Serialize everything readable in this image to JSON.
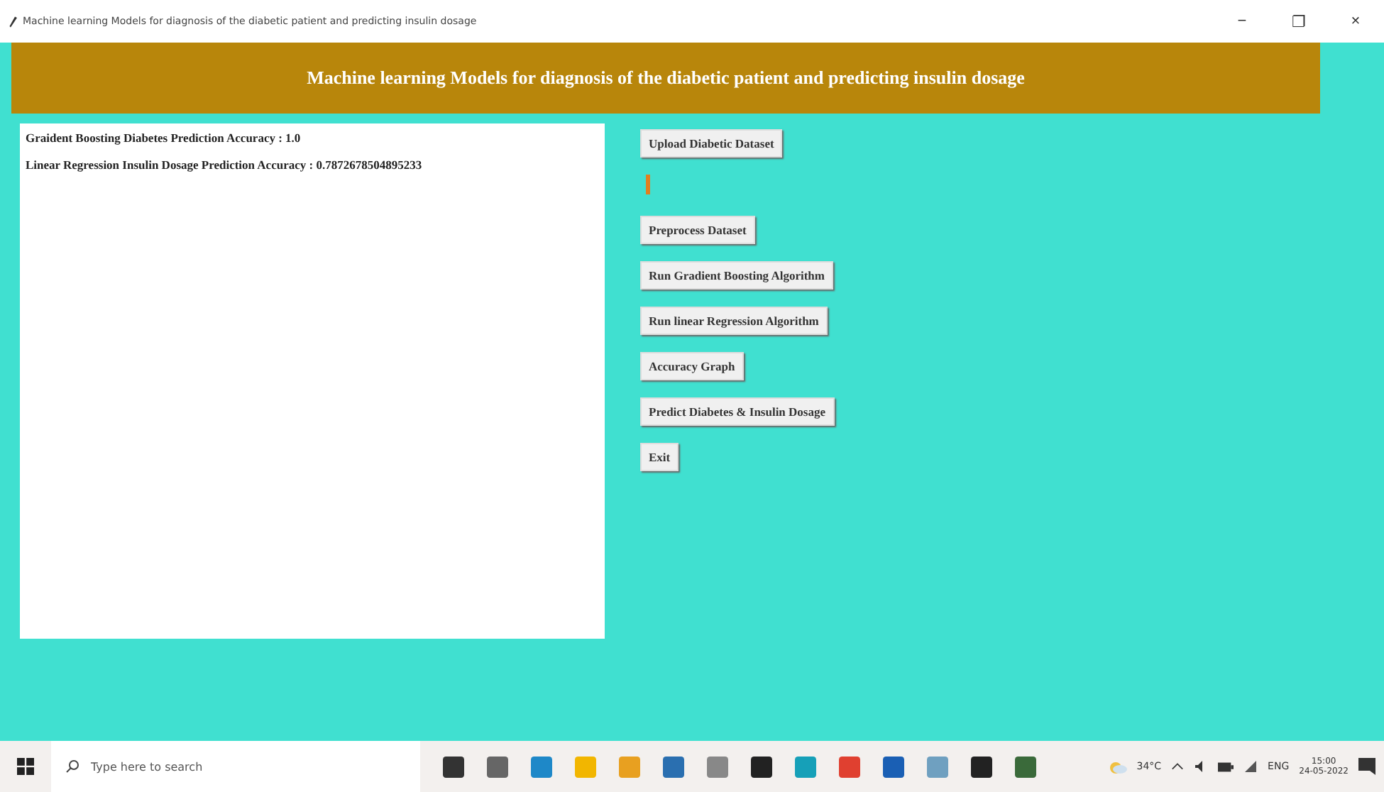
{
  "window": {
    "title": "Machine learning Models for diagnosis of the diabetic patient and predicting insulin dosage",
    "controls": [
      "−",
      "❐",
      "×"
    ]
  },
  "header": "Machine learning Models for diagnosis of the diabetic patient and predicting insulin dosage",
  "output_lines": [
    "Graident Boosting Diabetes Prediction Accuracy : 1.0",
    "Linear Regression Insulin Dosage Prediction Accuracy : 0.7872678504895233"
  ],
  "buttons": [
    {
      "kind": "button",
      "label": "Upload Diabetic Dataset"
    },
    {
      "kind": "marker"
    },
    {
      "kind": "button",
      "label": "Preprocess Dataset"
    },
    {
      "kind": "button",
      "label": "Run Gradient Boosting Algorithm"
    },
    {
      "kind": "button",
      "label": "Run linear Regression Algorithm"
    },
    {
      "kind": "button",
      "label": "Accuracy Graph"
    },
    {
      "kind": "button",
      "label": "Predict Diabetes & Insulin Dosage"
    },
    {
      "kind": "button",
      "label": "Exit"
    }
  ],
  "taskbar": {
    "search_placeholder": "Type here to search",
    "weather": "34°C",
    "language": "ENG",
    "time": "15:00",
    "date": "24-05-2022"
  }
}
